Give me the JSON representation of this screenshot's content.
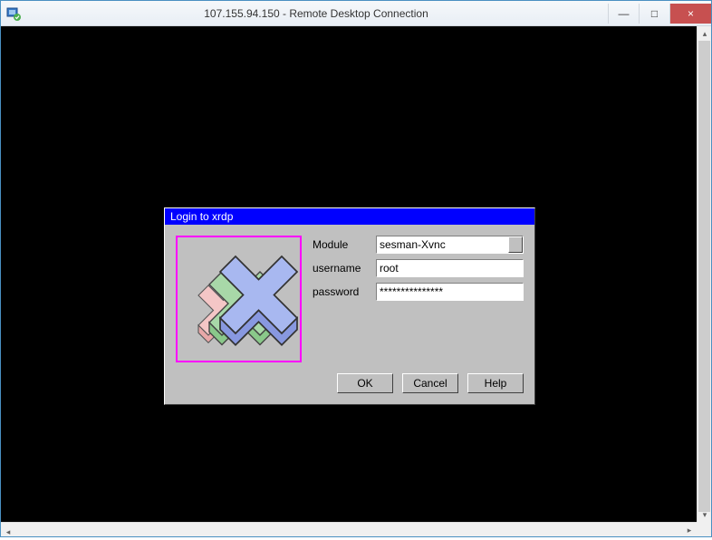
{
  "window": {
    "title": "107.155.94.150 - Remote Desktop Connection",
    "controls": {
      "minimize": "—",
      "maximize": "□",
      "close": "×"
    }
  },
  "xrdp": {
    "title": "Login to xrdp",
    "fields": {
      "module_label": "Module",
      "module_value": "sesman-Xvnc",
      "username_label": "username",
      "username_value": "root",
      "password_label": "password",
      "password_value": "***************"
    },
    "buttons": {
      "ok": "OK",
      "cancel": "Cancel",
      "help": "Help"
    }
  }
}
